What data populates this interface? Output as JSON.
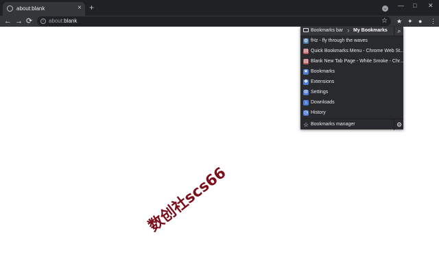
{
  "tab": {
    "title": "about:blank",
    "close": "×"
  },
  "newtab": "+",
  "window": {
    "minimize": "—",
    "maximize": "□",
    "close": "✕"
  },
  "nav": {
    "back": "←",
    "forward": "→",
    "reload": "⟳"
  },
  "omnibox": {
    "scheme": "about:",
    "host": "blank"
  },
  "popup": {
    "crumbs": [
      "Bookmarks bar",
      "My Bookmarks"
    ],
    "items": [
      {
        "label": "fHz - fly through the waves",
        "icon": "globe-icon",
        "color": "#4e79a7"
      },
      {
        "label": "Quick Bookmarks Menu - Chrome Web St...",
        "icon": "store-icon",
        "color": "#b85c5c"
      },
      {
        "label": "Blank New Tab Page - White Smoke - Chr...",
        "icon": "store-icon",
        "color": "#b85c5c"
      },
      {
        "label": "Bookmarks",
        "icon": "star-icon",
        "color": "#4f7fd6"
      },
      {
        "label": "Extensions",
        "icon": "puzzle-icon",
        "color": "#4f7fd6"
      },
      {
        "label": "Settings",
        "icon": "gear-icon",
        "color": "#4f7fd6"
      },
      {
        "label": "Downloads",
        "icon": "download-icon",
        "color": "#4f7fd6"
      },
      {
        "label": "History",
        "icon": "clock-icon",
        "color": "#4f7fd6"
      }
    ],
    "footer": "Bookmarks manager"
  },
  "watermark": "数创社scs66"
}
